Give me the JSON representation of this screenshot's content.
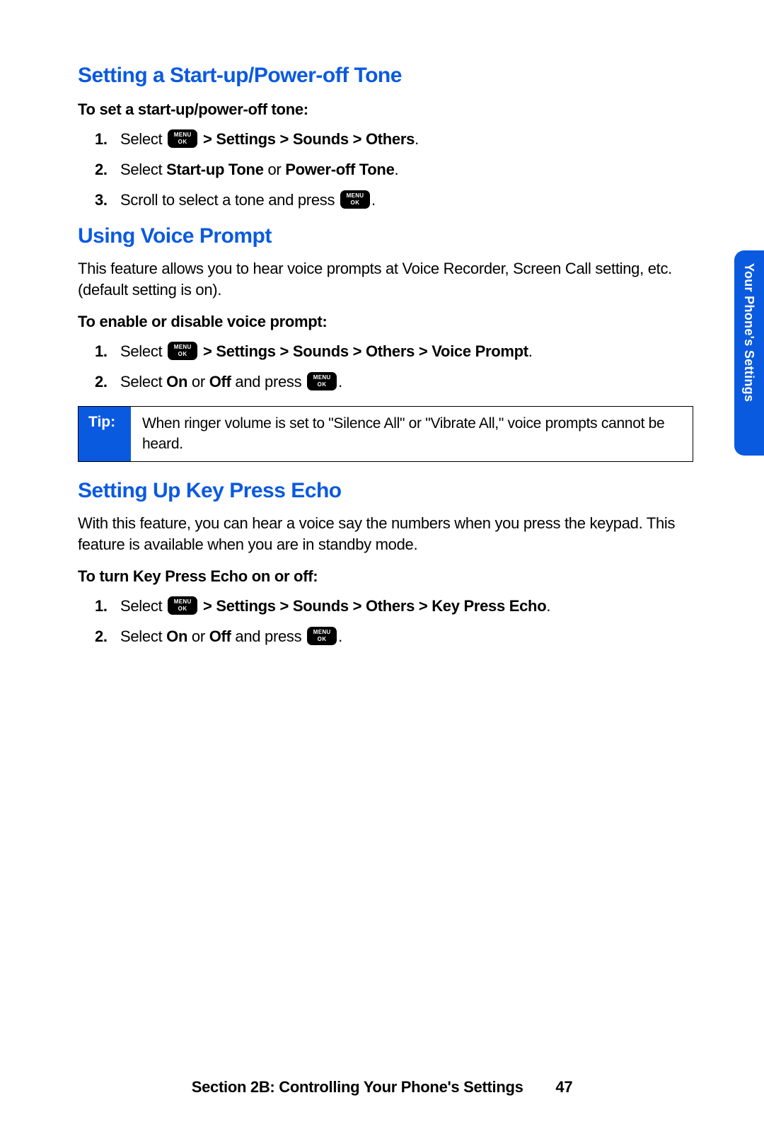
{
  "sideTab": "Your Phone's Settings",
  "sections": [
    {
      "heading": "Setting a Start-up/Power-off Tone",
      "sub": "To set a start-up/power-off tone:",
      "steps": [
        {
          "pre": "Select ",
          "icon": true,
          "boldAfterIcon": " > Settings > Sounds > Others",
          "tail": "."
        },
        {
          "pre": "Select ",
          "bold1": "Start-up Tone",
          "mid": " or ",
          "bold2": "Power-off Tone",
          "tail": "."
        },
        {
          "pre": "Scroll to select a tone and press ",
          "iconEnd": true,
          "tail": "."
        }
      ]
    },
    {
      "heading": "Using Voice Prompt",
      "intro": "This feature allows you to hear voice prompts at Voice Recorder, Screen Call setting, etc. (default setting is on).",
      "sub": "To enable or disable voice prompt:",
      "steps": [
        {
          "pre": "Select ",
          "icon": true,
          "boldAfterIcon": " > Settings > Sounds > Others > Voice Prompt",
          "tail": "."
        },
        {
          "pre": "Select ",
          "bold1": "On",
          "mid": " or ",
          "bold2": "Off",
          "tail2": " and press ",
          "iconEnd": true,
          "tail": "."
        }
      ],
      "tip": {
        "label": "Tip:",
        "text": "When ringer volume is set to \"Silence All\" or \"Vibrate All,\" voice prompts cannot be heard."
      }
    },
    {
      "heading": "Setting Up Key Press Echo",
      "intro": "With this feature, you can hear a voice say the numbers when you press the keypad. This feature is available when you are in standby mode.",
      "sub": "To turn Key Press Echo on or off:",
      "steps": [
        {
          "pre": "Select ",
          "icon": true,
          "boldAfterIcon": " > Settings > Sounds > Others > Key Press Echo",
          "tail": "."
        },
        {
          "pre": "Select ",
          "bold1": "On",
          "mid": " or ",
          "bold2": "Off",
          "tail2": " and press ",
          "iconEnd": true,
          "tail": "."
        }
      ]
    }
  ],
  "footer": {
    "text": "Section 2B: Controlling Your Phone's Settings",
    "page": "47"
  }
}
